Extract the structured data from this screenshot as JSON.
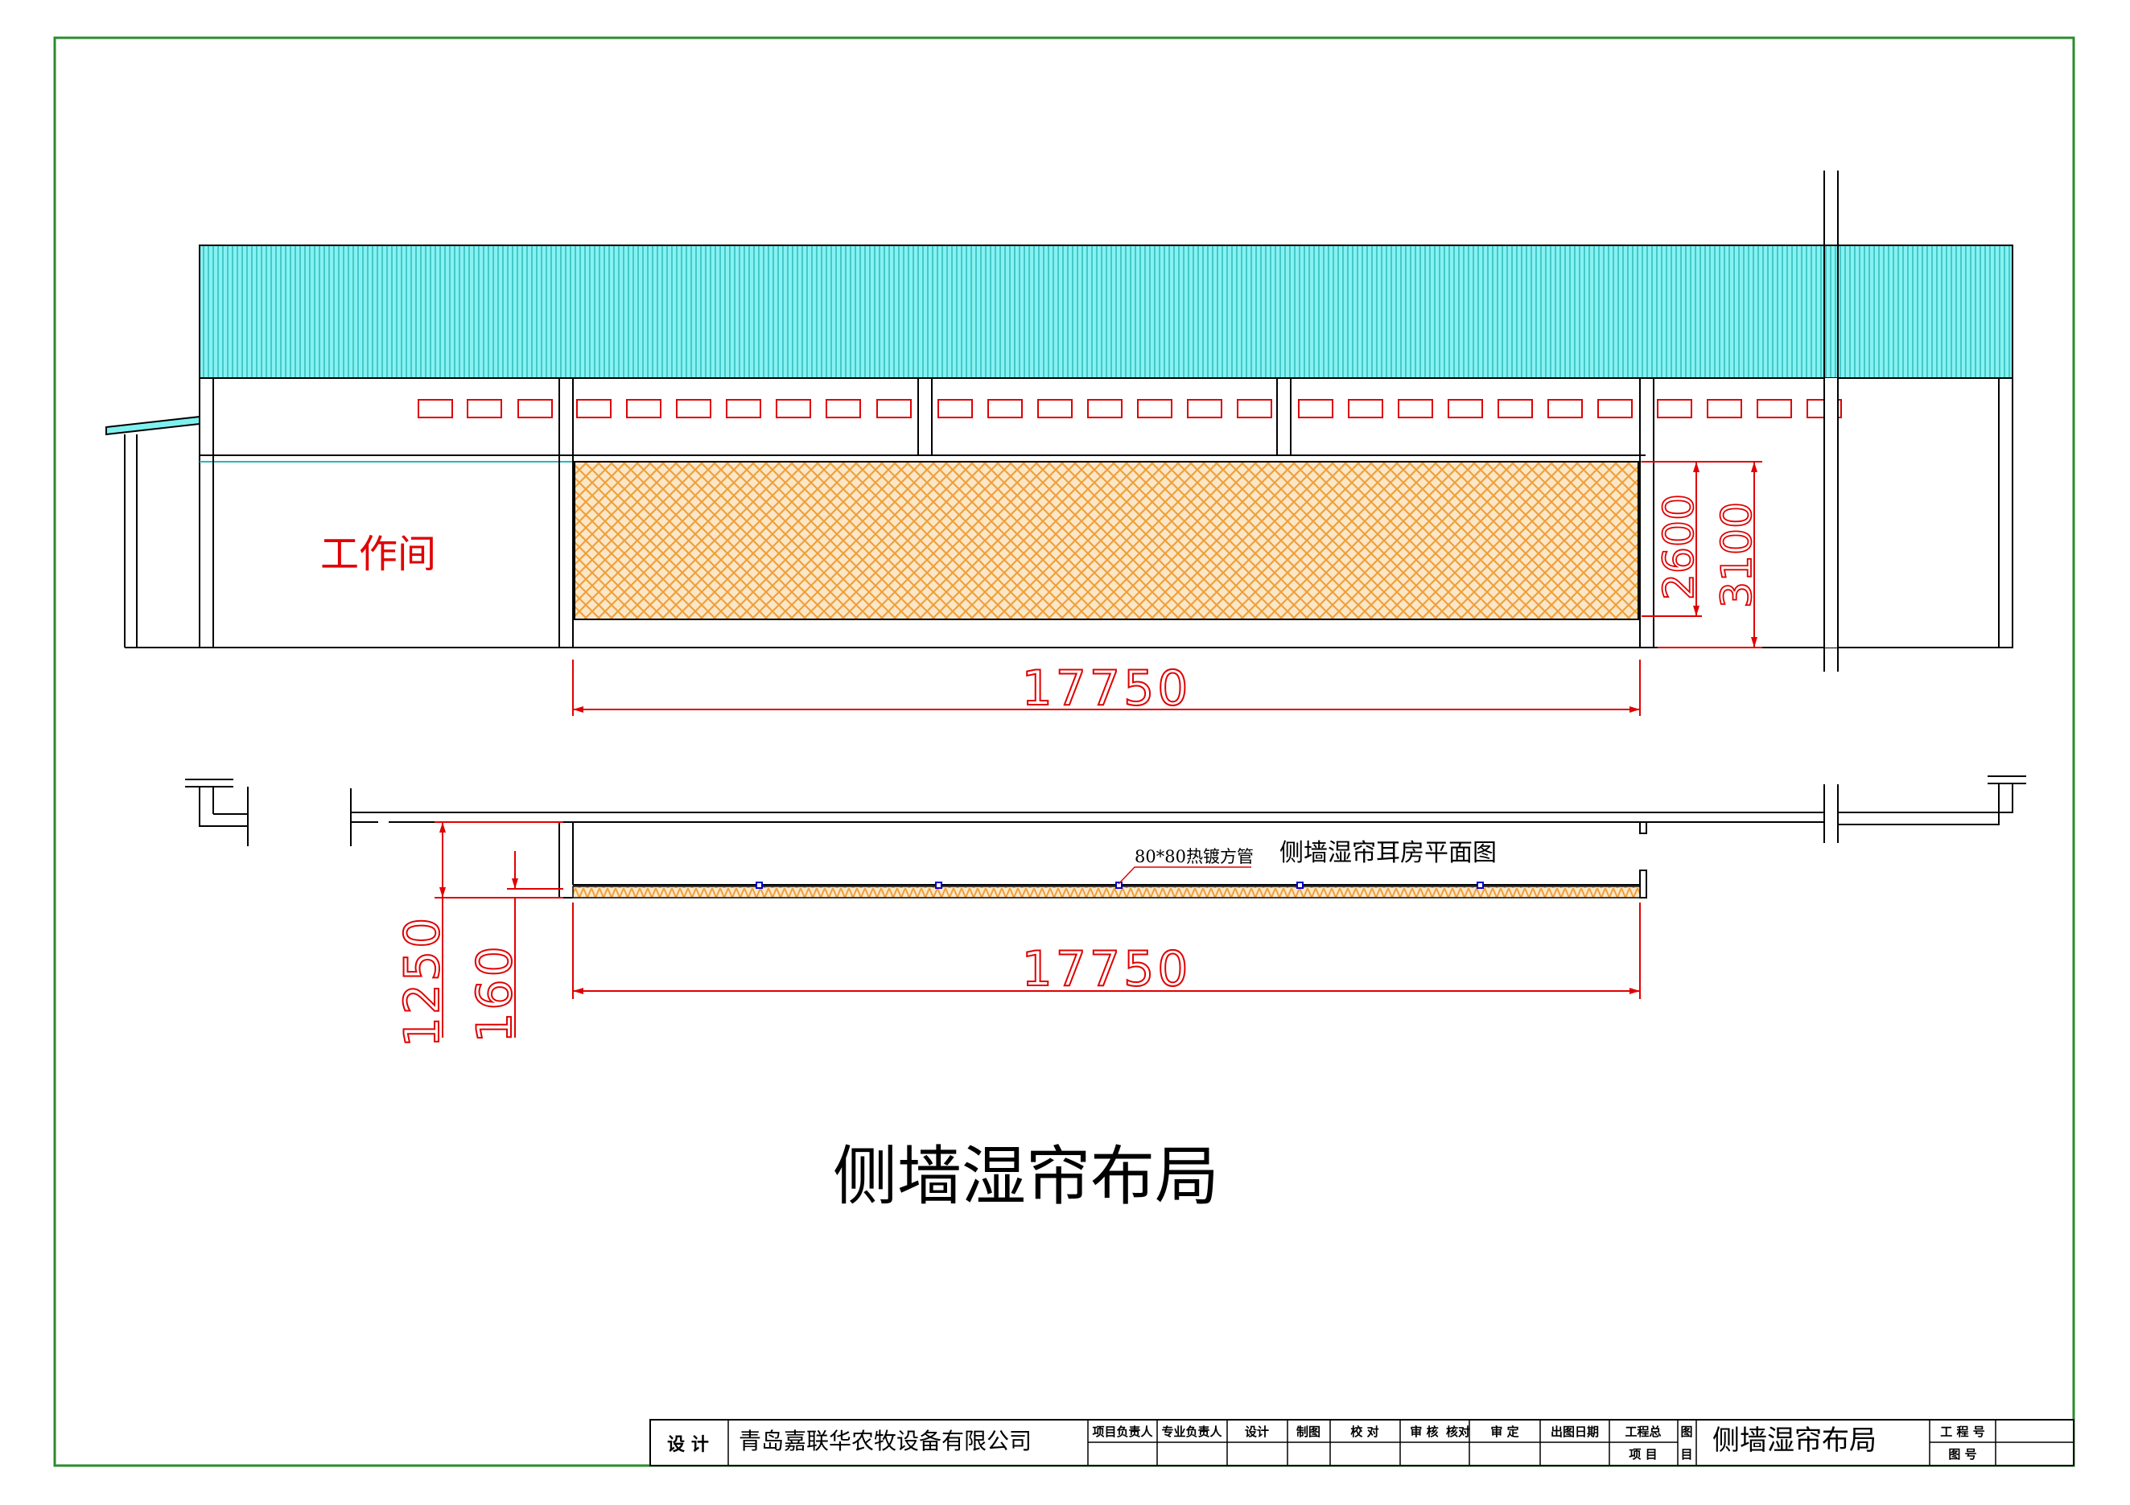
{
  "main_title": "侧墙湿帘布局",
  "elevation": {
    "room_label": "工作间",
    "dim_height_pad": "2600",
    "dim_height_total": "3100",
    "dim_length": "17750"
  },
  "plan": {
    "title": "侧墙湿帘耳房平面图",
    "pipe_note": "80*80热镀方管",
    "dim_length": "17750",
    "dim_offset": "1250",
    "dim_pad": "160"
  },
  "title_block": {
    "design_label": "设  计",
    "company": "青岛嘉联华农牧设备有限公司",
    "col_project_lead": "项目负责人",
    "col_specialty_lead": "专业负责人",
    "col_design": "设计",
    "col_drawing": "制图",
    "col_check": "校    对",
    "col_review": "审    核",
    "col_proofread": "核对",
    "col_approve": "审    定",
    "col_issue_date": "出图日期",
    "col_project_total": "工程总",
    "col_project_item": "项    目",
    "col_drawing_item_1": "图",
    "col_drawing_item_2": "目",
    "drawing_title": "侧墙湿帘布局",
    "label_project_no": "工 程 号",
    "label_drawing_no": "图    号"
  },
  "colors": {
    "frame": "#2e8b2e",
    "roof": "#7ff0f0",
    "roof_stripe": "#2ab7b7",
    "pad": "#f3a94a",
    "dimension": "#e00000",
    "line": "#000000"
  }
}
